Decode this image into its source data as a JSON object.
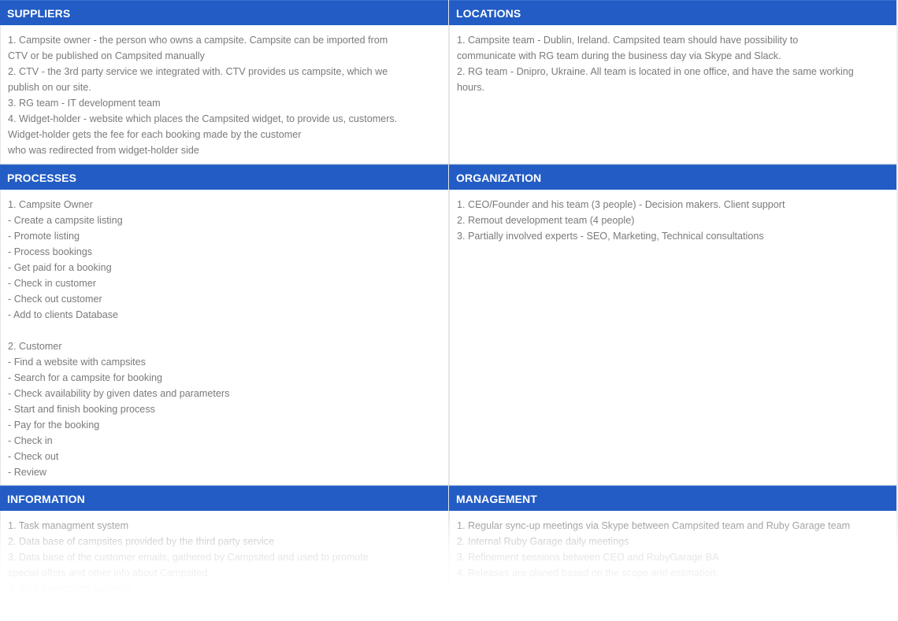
{
  "sections": {
    "suppliers": {
      "title": "SUPPLIERS",
      "lines": [
        "1. Campsite owner - the person who owns a campsite. Campsite can be imported from",
        "CTV or be published on Campsited manually",
        "2. CTV - the 3rd party service we integrated with. CTV provides us campsite, which we",
        "publish on our site.",
        "3. RG team - IT development team",
        "4. Widget-holder - website which places the Campsited widget, to provide us, customers.",
        "Widget-holder gets the fee for each booking made by the customer",
        "who was redirected from widget-holder side"
      ]
    },
    "locations": {
      "title": "LOCATIONS",
      "lines": [
        "1. Campsite team - Dublin, Ireland. Campsited team should have possibility to",
        "communicate with RG team during the business day via Skype and Slack.",
        "2. RG team - Dnipro, Ukraine. All team is located in one office, and have the same working",
        "hours."
      ]
    },
    "processes": {
      "title": "PROCESSES",
      "lines": [
        "1. Campsite Owner",
        "- Create a campsite listing",
        "- Promote listing",
        "- Process bookings",
        "- Get paid for a booking",
        "- Check in customer",
        "- Check out customer",
        "- Add to clients Database",
        "",
        "2. Customer",
        "- Find a website with campsites",
        "- Search for a campsite for booking",
        "- Check availability by given dates and parameters",
        "- Start and finish booking process",
        "- Pay for the booking",
        "- Check in",
        "- Check out",
        "- Review"
      ]
    },
    "organization": {
      "title": "ORGANIZATION",
      "lines": [
        "1. CEO/Founder and his team (3 people) - Decision makers. Client support",
        "2. Remout development team (4 people)",
        "3. Partially involved experts - SEO, Marketing, Technical consultations"
      ]
    },
    "information": {
      "title": "INFORMATION",
      "lines": [
        "1. Task managment system",
        "2. Data base of campsites provided by the third party service",
        "3. Data base of the customer emails, gathered by Campsited and used to promote",
        "special offers and other info about Campsited",
        "4. Web application analytics"
      ]
    },
    "management": {
      "title": "MANAGEMENT",
      "lines": [
        "1. Regular sync-up meetings via Skype between Campsited team and Ruby Garage team",
        "2. Internal Ruby Garage daily meetings",
        "3. Refinement sessions between CEO and RubyGarage BA",
        "4. Releases are planed based on the scope and estimation."
      ]
    }
  },
  "colors": {
    "header_bg": "#225cc4",
    "header_text": "#ffffff",
    "body_text": "#7a7a7a"
  }
}
